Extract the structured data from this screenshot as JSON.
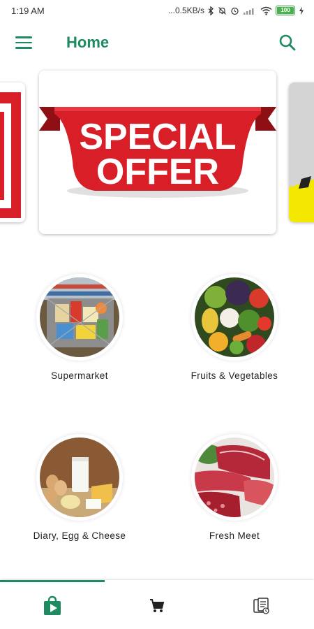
{
  "status_bar": {
    "time": "1:19 AM",
    "network_speed": "...0.5KB/s",
    "battery_level": "100",
    "icons": [
      "bluetooth-icon",
      "bell-off-icon",
      "alarm-icon",
      "signal-icon",
      "wifi-icon",
      "battery-icon",
      "charging-icon"
    ]
  },
  "app_bar": {
    "title": "Home",
    "menu_icon": "menu-icon",
    "search_icon": "search-icon"
  },
  "banner": {
    "line1": "SPECIAL",
    "line2": "OFFER"
  },
  "categories": [
    {
      "label": "Supermarket",
      "icon": "supermarket-image"
    },
    {
      "label": "Fruits & Vegetables",
      "icon": "fruits-vegetables-image"
    },
    {
      "label": "Diary, Egg & Cheese",
      "icon": "dairy-egg-cheese-image"
    },
    {
      "label": "Fresh Meet",
      "icon": "fresh-meat-image"
    }
  ],
  "bottom_nav": {
    "items": [
      {
        "icon": "shopping-bag-icon",
        "active": true
      },
      {
        "icon": "cart-icon",
        "active": false
      },
      {
        "icon": "orders-icon",
        "active": false
      }
    ]
  },
  "colors": {
    "accent": "#1d8a60",
    "banner_red": "#d81e27"
  }
}
